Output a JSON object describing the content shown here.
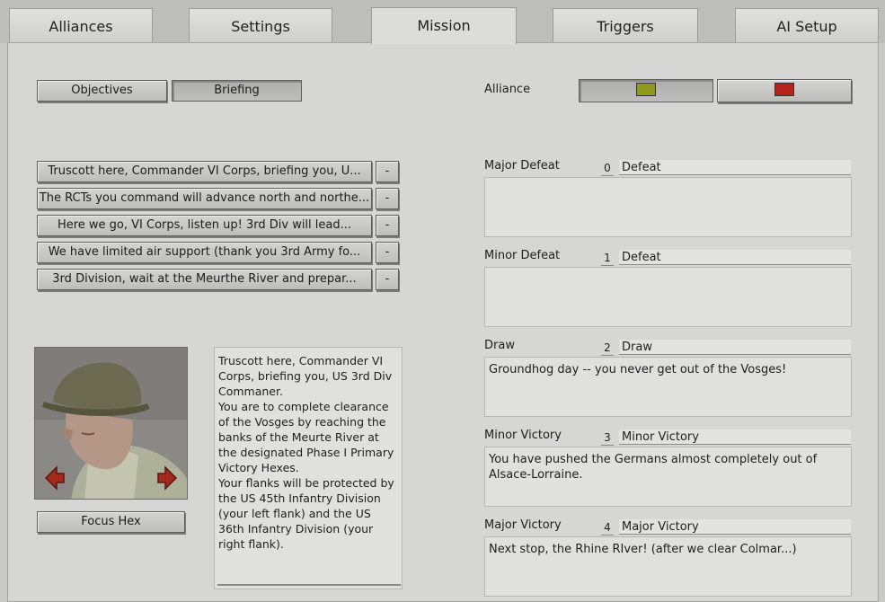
{
  "tabs": [
    "Alliances",
    "Settings",
    "Mission",
    "Triggers",
    "AI Setup"
  ],
  "left": {
    "objectives_label": "Objectives",
    "briefing_label": "Briefing",
    "briefing_items": [
      "Truscott here, Commander VI Corps, briefing you, U...",
      "The RCTs you command will advance north and northe...",
      "Here we go, VI Corps, listen up! 3rd Div will lead...",
      "We have limited air support (thank you 3rd Army fo...",
      "3rd Division, wait at the Meurthe River and prepar..."
    ],
    "remove_label": "-",
    "focus_hex_label": "Focus Hex",
    "briefing_text": "Truscott here, Commander VI Corps, briefing you, US 3rd Div Commaner.\nYou are to complete clearance of the Vosges by reaching the banks of the Meurte River at the designated Phase I Primary Victory Hexes.\nYour flanks will be protected by the US 45th Infantry Division (your left flank) and the US 36th Infantry Division (your right flank)."
  },
  "right": {
    "alliance_label": "Alliance",
    "alliance_colors": [
      "#8f9a1c",
      "#b8231b"
    ],
    "outcomes": [
      {
        "label": "Major Defeat",
        "num": "0",
        "title": "Defeat",
        "text": ""
      },
      {
        "label": "Minor Defeat",
        "num": "1",
        "title": "Defeat",
        "text": ""
      },
      {
        "label": "Draw",
        "num": "2",
        "title": "Draw",
        "text": "Groundhog day -- you never get out of the Vosges!"
      },
      {
        "label": "Minor Victory",
        "num": "3",
        "title": "Minor Victory",
        "text": "You have pushed the Germans almost completely out of Alsace-Lorraine."
      },
      {
        "label": "Major Victory",
        "num": "4",
        "title": "Major Victory",
        "text": "Next stop, the Rhine RIver! (after we clear Colmar...)"
      }
    ]
  },
  "icons": {
    "prev": "arrow-left-icon",
    "next": "arrow-right-icon"
  }
}
